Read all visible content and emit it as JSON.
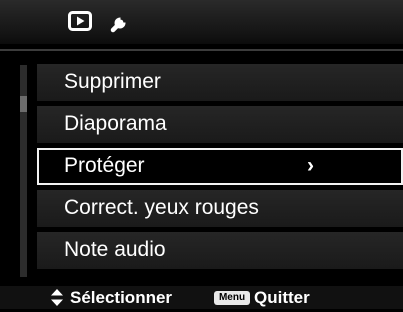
{
  "tabs": [
    {
      "icon": "play-icon"
    },
    {
      "icon": "wrench-icon"
    }
  ],
  "menu": {
    "items": [
      {
        "label": "Supprimer"
      },
      {
        "label": "Diaporama"
      },
      {
        "label": "Protéger",
        "chevron": "›"
      },
      {
        "label": "Correct. yeux rouges"
      },
      {
        "label": "Note audio"
      }
    ],
    "selected_index": 2
  },
  "footer": {
    "select_label": "Sélectionner",
    "menu_badge": "Menu",
    "quit_label": "Quitter"
  },
  "colors": {
    "background": "#000000",
    "item": "#202020",
    "selection_border": "#f2f2f2",
    "text": "#ffffff"
  }
}
